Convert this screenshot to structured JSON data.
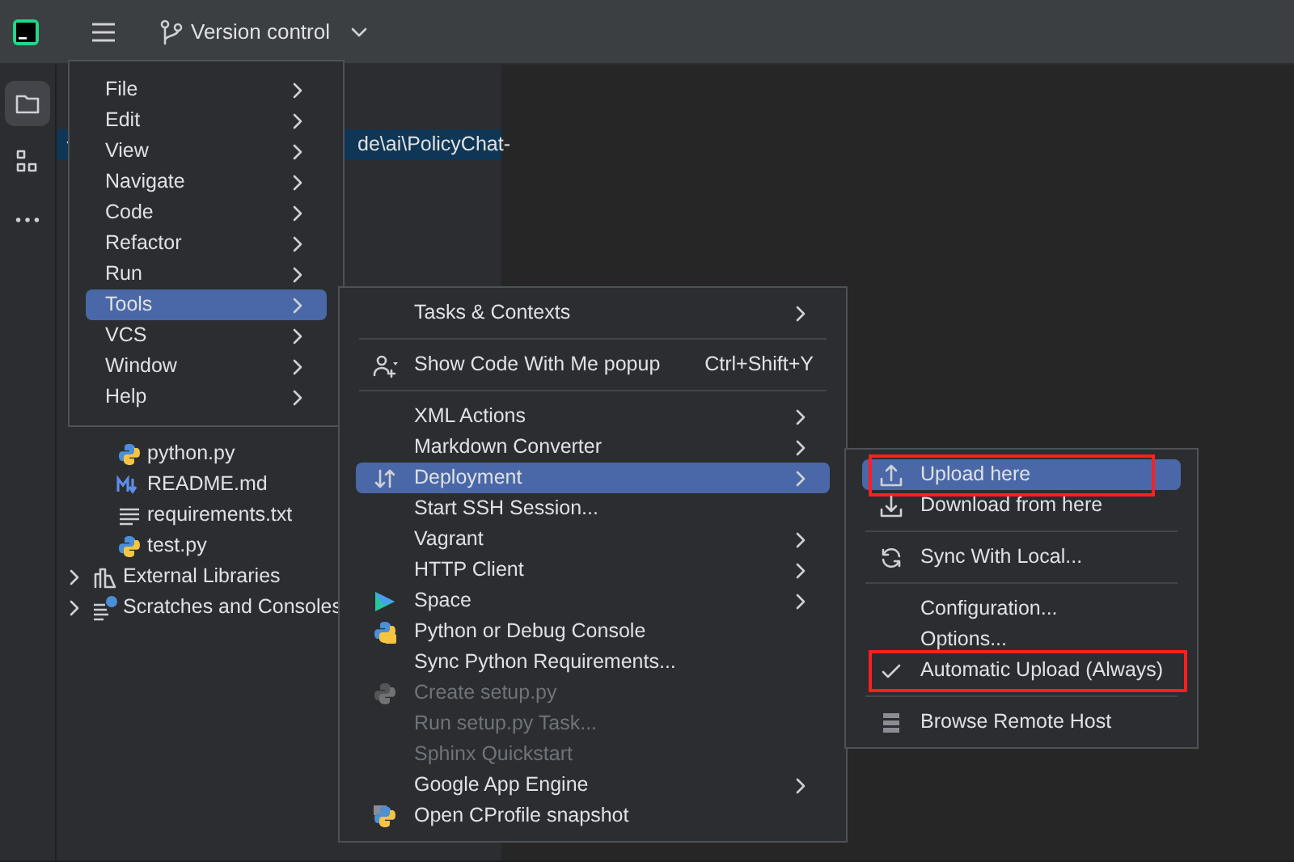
{
  "toolbar": {
    "project_widget": "Version control"
  },
  "tool_strip": [
    {
      "kind": "folder",
      "selected": true
    },
    {
      "kind": "structure",
      "selected": false
    },
    {
      "kind": "more",
      "selected": false
    }
  ],
  "project_tree": [
    {
      "label": "de\\ai\\PolicyChat-",
      "selected": true,
      "expanded": true,
      "children": [
        {
          "label": "python.py",
          "kind": "python"
        },
        {
          "label": "README.md",
          "kind": "markdown"
        },
        {
          "label": "requirements.txt",
          "kind": "text"
        },
        {
          "label": "test.py",
          "kind": "python"
        }
      ]
    },
    {
      "label": "External Libraries",
      "kind": "library",
      "expanded": false
    },
    {
      "label": "Scratches and Consoles",
      "kind": "scratch",
      "expanded": false
    }
  ],
  "main_menu": [
    {
      "label": "File",
      "selected": false
    },
    {
      "label": "Edit",
      "selected": false
    },
    {
      "label": "View",
      "selected": false
    },
    {
      "label": "Navigate",
      "selected": false
    },
    {
      "label": "Code",
      "selected": false
    },
    {
      "label": "Refactor",
      "selected": false
    },
    {
      "label": "Run",
      "selected": false
    },
    {
      "label": "Tools",
      "selected": true
    },
    {
      "label": "VCS",
      "selected": false
    },
    {
      "label": "Window",
      "selected": false
    },
    {
      "label": "Help",
      "selected": false
    }
  ],
  "tools_menu": [
    {
      "label": "Tasks & Contexts",
      "submenu": true,
      "selected": false
    },
    {
      "label": "Show Code With Me popup",
      "kind": "person-add",
      "shortcut": "Ctrl+Shift+Y",
      "separator_before": true,
      "selected": false
    },
    {
      "label": "XML Actions",
      "submenu": true,
      "separator_before": true,
      "selected": false
    },
    {
      "label": "Markdown Converter",
      "submenu": true,
      "selected": false
    },
    {
      "label": "Deployment",
      "kind": "transfer",
      "submenu": true,
      "selected": true
    },
    {
      "label": "Start SSH Session...",
      "selected": false
    },
    {
      "label": "Vagrant",
      "submenu": true,
      "selected": false
    },
    {
      "label": "HTTP Client",
      "submenu": true,
      "selected": false
    },
    {
      "label": "Space",
      "kind": "space",
      "submenu": true,
      "selected": false
    },
    {
      "label": "Python or Debug Console",
      "kind": "python-console",
      "selected": false
    },
    {
      "label": "Sync Python Requirements...",
      "selected": false
    },
    {
      "label": "Create setup.py",
      "kind": "python",
      "disabled": true,
      "selected": false
    },
    {
      "label": "Run setup.py Task...",
      "disabled": true,
      "selected": false
    },
    {
      "label": "Sphinx Quickstart",
      "disabled": true,
      "selected": false
    },
    {
      "label": "Google App Engine",
      "submenu": true,
      "selected": false
    },
    {
      "label": "Open CProfile snapshot",
      "kind": "profile",
      "selected": false
    }
  ],
  "deployment_menu": [
    {
      "label": "Upload here",
      "kind": "upload",
      "selected": true,
      "annotated": true
    },
    {
      "label": "Download from here",
      "kind": "download",
      "selected": false
    },
    {
      "label": "Sync With Local...",
      "kind": "sync",
      "separator_before": true,
      "selected": false
    },
    {
      "label": "Configuration...",
      "separator_before": true,
      "selected": false
    },
    {
      "label": "Options...",
      "selected": false
    },
    {
      "label": "Automatic Upload (Always)",
      "checked": true,
      "selected": false,
      "annotated": true
    },
    {
      "label": "Browse Remote Host",
      "kind": "server",
      "separator_before": true,
      "selected": false
    }
  ]
}
